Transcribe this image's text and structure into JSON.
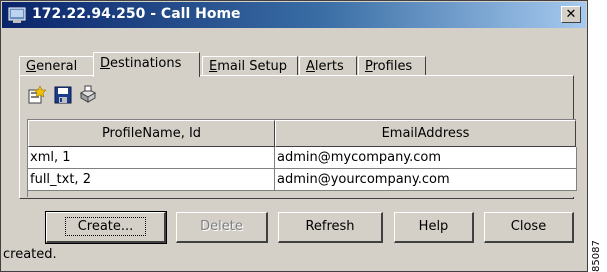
{
  "window": {
    "title": "172.22.94.250 - Call Home",
    "close_glyph": "✕"
  },
  "tabs": [
    {
      "label": "General",
      "mnemonic": "G",
      "rest": "eneral"
    },
    {
      "label": "Destinations",
      "mnemonic": "D",
      "rest": "estinations",
      "active": true
    },
    {
      "label": "Email Setup",
      "mnemonic": "E",
      "rest": "mail Setup"
    },
    {
      "label": "Alerts",
      "mnemonic": "A",
      "rest": "lerts"
    },
    {
      "label": "Profiles",
      "mnemonic": "P",
      "rest": "rofiles"
    }
  ],
  "toolbar": {
    "icons": [
      "create-row-icon",
      "save-icon",
      "apply-icon"
    ]
  },
  "table": {
    "columns": [
      "ProfileName, Id",
      "EmailAddress"
    ],
    "rows": [
      [
        "xml, 1",
        "admin@mycompany.com"
      ],
      [
        "full_txt, 2",
        "admin@yourcompany.com"
      ]
    ]
  },
  "buttons": {
    "create": "Create...",
    "delete": "Delete",
    "refresh": "Refresh",
    "help": "Help",
    "close": "Close"
  },
  "status_text": "created.",
  "figure_number": "85087",
  "colors": {
    "titlebar_start": "#0a246a",
    "titlebar_end": "#a6caf0",
    "face": "#d4d0c8"
  }
}
